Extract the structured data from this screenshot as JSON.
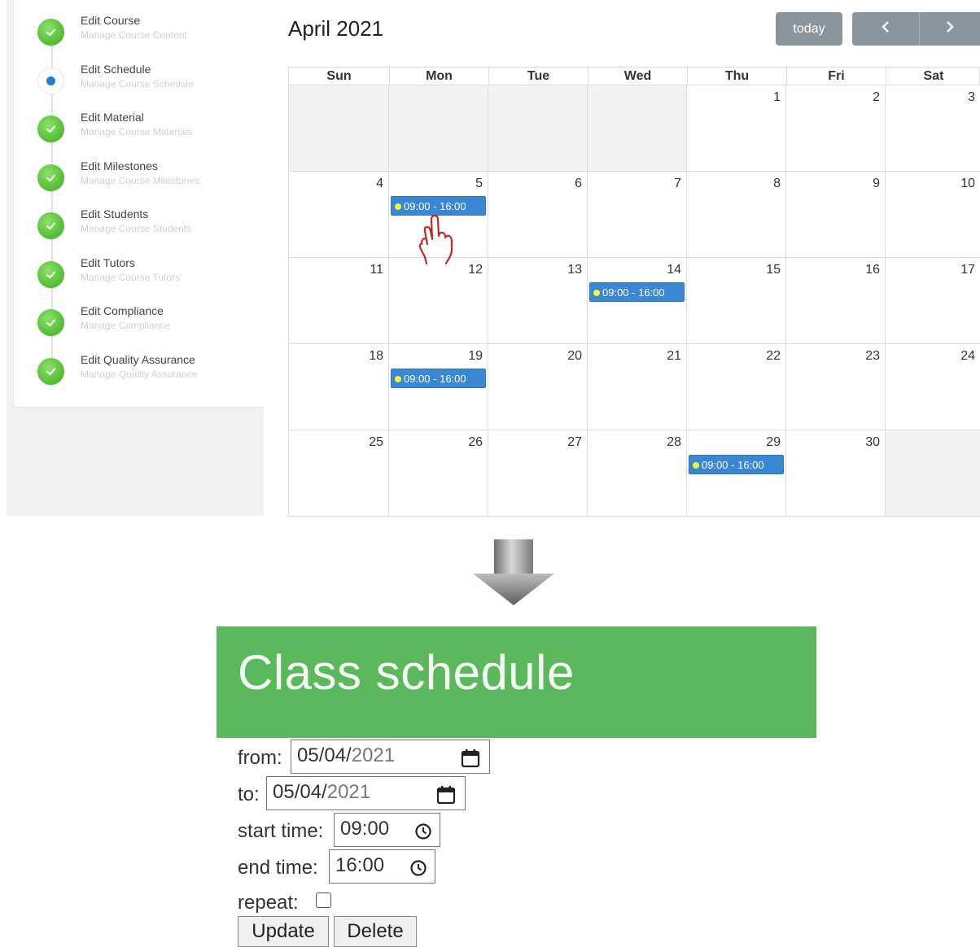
{
  "sidebar": {
    "steps": [
      {
        "title": "Edit Course",
        "subtitle": "Manage Course Content",
        "status": "done"
      },
      {
        "title": "Edit Schedule",
        "subtitle": "Manage Course Schedule",
        "status": "current"
      },
      {
        "title": "Edit Material",
        "subtitle": "Manage Course Materials",
        "status": "done"
      },
      {
        "title": "Edit Milestones",
        "subtitle": "Manage Course Milestones",
        "status": "done"
      },
      {
        "title": "Edit Students",
        "subtitle": "Manage Course Students",
        "status": "done"
      },
      {
        "title": "Edit Tutors",
        "subtitle": "Manage Course Tutors",
        "status": "done"
      },
      {
        "title": "Edit Compliance",
        "subtitle": "Manage Compliance",
        "status": "done"
      },
      {
        "title": "Edit Quality Assurance",
        "subtitle": "Manage Quality Assurance",
        "status": "done"
      }
    ]
  },
  "calendar": {
    "title": "April 2021",
    "today_label": "today",
    "prev_label": "‹",
    "next_label": "›",
    "weekdays": [
      "Sun",
      "Mon",
      "Tue",
      "Wed",
      "Thu",
      "Fri",
      "Sat"
    ],
    "weeks": [
      [
        "",
        "",
        "",
        "",
        "1",
        "2",
        "3"
      ],
      [
        "4",
        "5",
        "6",
        "7",
        "8",
        "9",
        "10"
      ],
      [
        "11",
        "12",
        "13",
        "14",
        "15",
        "16",
        "17"
      ],
      [
        "18",
        "19",
        "20",
        "21",
        "22",
        "23",
        "24"
      ],
      [
        "25",
        "26",
        "27",
        "28",
        "29",
        "30",
        ""
      ]
    ],
    "events": [
      {
        "week": 1,
        "day": 1,
        "label": "09:00 - 16:00"
      },
      {
        "week": 2,
        "day": 3,
        "label": "09:00 - 16:00"
      },
      {
        "week": 3,
        "day": 1,
        "label": "09:00 - 16:00"
      },
      {
        "week": 4,
        "day": 4,
        "label": "09:00 - 16:00"
      }
    ],
    "colors": {
      "event": "#3a87d6",
      "event_dot": "#f5f53a",
      "button": "#8c959c",
      "off_day": "#f2f2f2"
    }
  },
  "form": {
    "title": "Class schedule",
    "banner_color": "#5cb85c",
    "from_label": "from:",
    "from_value_a": "05/04/",
    "from_value_b": "2021",
    "to_label": "to:",
    "to_value_a": "05/04/",
    "to_value_b": "2021",
    "start_label": "start time:",
    "start_value": "09:00",
    "end_label": "end time:",
    "end_value": "16:00",
    "repeat_label": "repeat:",
    "repeat_checked": false,
    "update_label": "Update",
    "delete_label": "Delete"
  },
  "icons": [
    "check-icon",
    "calendar-icon",
    "clock-icon",
    "pointer-hand-icon",
    "down-arrow-icon"
  ]
}
